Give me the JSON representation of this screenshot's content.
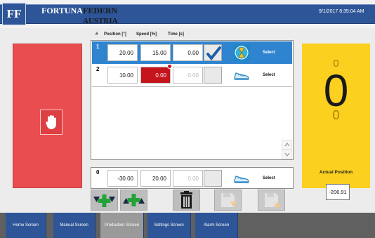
{
  "header": {
    "logo": "FF",
    "brand_line1": "FORTUNA",
    "brand_line2": "FEDERN",
    "brand_line3": "AUSTRIA",
    "datetime": "9/1/2017 8:35:04 AM"
  },
  "columns": {
    "index": "#",
    "position": "Position [°]",
    "speed": "Speed [%]",
    "time": "Time [s]"
  },
  "rows": [
    {
      "index": "1",
      "position": "20.00",
      "speed": "15.00",
      "time": "0.00",
      "checked": true,
      "icon": "hourglass-icon",
      "select": "Select",
      "selected": true
    },
    {
      "index": "2",
      "position": "10.00",
      "speed": "0.00",
      "time": "0.00",
      "checked": false,
      "icon": "shoe-icon",
      "select": "Select",
      "selected": false,
      "speed_error": true
    }
  ],
  "home_row": {
    "index": "0",
    "position": "-30.00",
    "speed": "20.00",
    "time": "0.00",
    "icon": "shoe-icon",
    "select": "Select"
  },
  "toolbar": [
    {
      "name": "insert-below-icon"
    },
    {
      "name": "insert-above-icon"
    },
    {
      "name": "trash-icon"
    },
    {
      "name": "save-down-icon"
    },
    {
      "name": "save-up-icon"
    }
  ],
  "actual": {
    "top_value": "0",
    "big_value": "0",
    "bottom_value": "0",
    "label": "Actual Position",
    "position_value": "-206.91"
  },
  "nav": [
    "Home Screen",
    "Manual Screen",
    "Production Screen",
    "Settings Screen",
    "Alarm Screen"
  ],
  "colors": {
    "stop": "#ea4d4f",
    "selected_row": "#2f84d0",
    "actual_panel": "#fbd01e",
    "nav_blue": "#2e5597",
    "error": "#c6141d"
  }
}
